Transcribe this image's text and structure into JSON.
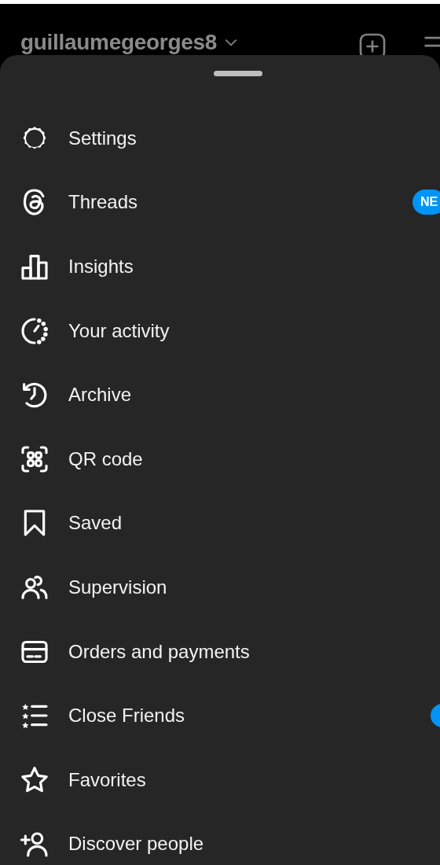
{
  "header": {
    "username": "guillaumegeorges8"
  },
  "menu": [
    {
      "label": "Settings",
      "unread": false
    },
    {
      "label": "Threads",
      "badge": "NE",
      "unread": false
    },
    {
      "label": "Insights",
      "unread": false
    },
    {
      "label": "Your activity",
      "unread": false
    },
    {
      "label": "Archive",
      "unread": false
    },
    {
      "label": "QR code",
      "unread": false
    },
    {
      "label": "Saved",
      "unread": false
    },
    {
      "label": "Supervision",
      "unread": false
    },
    {
      "label": "Orders and payments",
      "unread": false
    },
    {
      "label": "Close Friends",
      "unread": true
    },
    {
      "label": "Favorites",
      "unread": false
    },
    {
      "label": "Discover people",
      "unread": false
    }
  ]
}
